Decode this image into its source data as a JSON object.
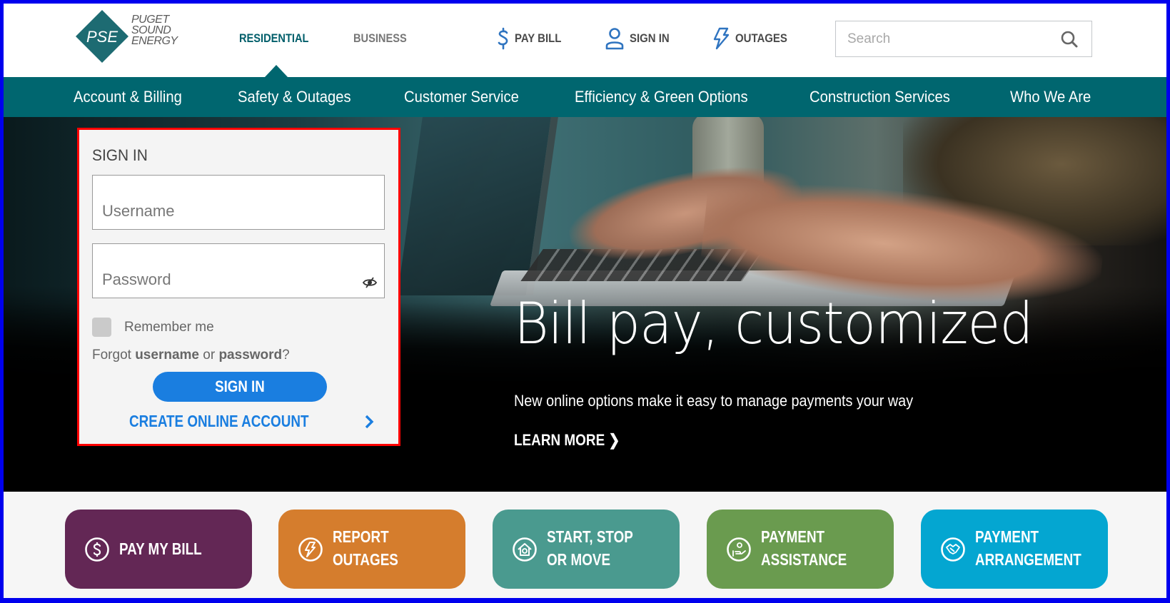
{
  "header": {
    "logo": {
      "mark": "PSE",
      "words": [
        "PUGET",
        "SOUND",
        "ENERGY"
      ]
    },
    "audience_tabs": [
      {
        "label": "RESIDENTIAL",
        "active": true
      },
      {
        "label": "BUSINESS",
        "active": false
      }
    ],
    "utility_links": [
      {
        "label": "PAY BILL",
        "icon": "dollar-icon"
      },
      {
        "label": "SIGN IN",
        "icon": "user-icon"
      },
      {
        "label": "OUTAGES",
        "icon": "lightning-icon"
      }
    ],
    "search": {
      "placeholder": "Search",
      "value": ""
    }
  },
  "nav": {
    "items": [
      "Account & Billing",
      "Safety & Outages",
      "Customer Service",
      "Efficiency & Green Options",
      "Construction Services",
      "Who We Are"
    ]
  },
  "signin": {
    "title": "SIGN IN",
    "username_placeholder": "Username",
    "password_placeholder": "Password",
    "remember_label": "Remember me",
    "remember_checked": false,
    "forgot_prefix": "Forgot",
    "forgot_username": "username",
    "forgot_or": "or",
    "forgot_password": "password",
    "forgot_suffix": "?",
    "button_label": "SIGN IN",
    "create_account_label": "CREATE ONLINE ACCOUNT"
  },
  "hero": {
    "title": "Bill pay, customized",
    "subtitle": "New online options make it easy to manage payments your way",
    "cta": "LEARN MORE"
  },
  "tiles": [
    {
      "label": "PAY MY BILL",
      "icon": "dollar-circle-icon",
      "color": "#632755"
    },
    {
      "label": "REPORT\nOUTAGES",
      "icon": "lightning-circle-icon",
      "color": "#d57d2d"
    },
    {
      "label": "START, STOP\nOR MOVE",
      "icon": "home-circle-icon",
      "color": "#4a9a8f"
    },
    {
      "label": "PAYMENT\nASSISTANCE",
      "icon": "hand-circle-icon",
      "color": "#6a9b4f"
    },
    {
      "label": "PAYMENT\nARRANGEMENT",
      "icon": "handshake-circle-icon",
      "color": "#04a6d1"
    }
  ],
  "colors": {
    "brand_teal": "#00666f",
    "link_blue": "#1a7ee0",
    "icon_blue": "#2f74c0",
    "highlight_border": "#ff0000"
  }
}
